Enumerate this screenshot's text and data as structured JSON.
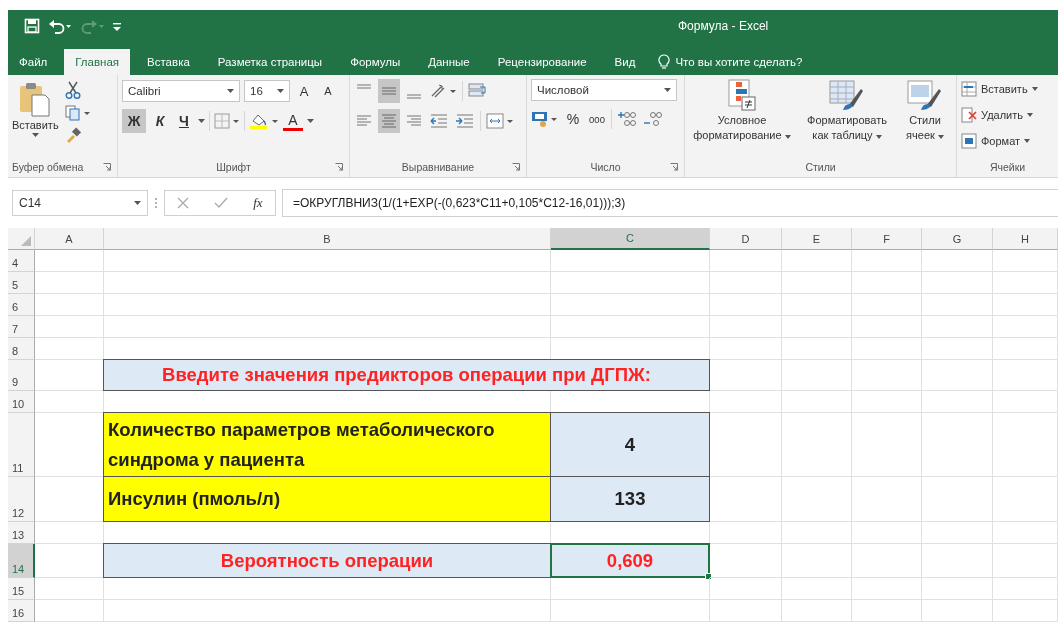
{
  "window": {
    "title": "Формула - Excel"
  },
  "tabs": [
    {
      "label": "Файл",
      "selected": false
    },
    {
      "label": "Главная",
      "selected": true
    },
    {
      "label": "Вставка",
      "selected": false
    },
    {
      "label": "Разметка страницы",
      "selected": false
    },
    {
      "label": "Формулы",
      "selected": false
    },
    {
      "label": "Данные",
      "selected": false
    },
    {
      "label": "Рецензирование",
      "selected": false
    },
    {
      "label": "Вид",
      "selected": false
    }
  ],
  "tell_me": {
    "placeholder": "Что вы хотите сделать?"
  },
  "ribbon": {
    "clipboard": {
      "paste": "Вставить",
      "label": "Буфер обмена"
    },
    "font": {
      "font_name": "Calibri",
      "font_size": "16",
      "grow": "A",
      "shrink": "A",
      "font_color_letter": "A",
      "label": "Шрифт",
      "style_buttons": [
        {
          "label": "Ж",
          "kind": "bold",
          "selected": true
        },
        {
          "label": "К",
          "kind": "italic",
          "selected": false
        },
        {
          "label": "Ч",
          "kind": "underline",
          "selected": false
        }
      ]
    },
    "alignment": {
      "label": "Выравнивание"
    },
    "number": {
      "format": "Числовой",
      "percent": "%",
      "thousands": "000",
      "label": "Число"
    },
    "styles": {
      "buttons": [
        {
          "label": "Условное форматирование",
          "kind": "conditional"
        },
        {
          "label": "Форматировать как таблицу",
          "kind": "table"
        },
        {
          "label": "Стили ячеек",
          "kind": "cell"
        }
      ],
      "label": "Стили"
    },
    "cells": {
      "buttons": [
        {
          "label": "Вставить",
          "kind": "insert"
        },
        {
          "label": "Удалить",
          "kind": "delete"
        },
        {
          "label": "Формат",
          "kind": "format"
        }
      ],
      "label": "Ячейки"
    }
  },
  "formula_bar": {
    "name_box": "C14",
    "fx": "fx",
    "formula": "=ОКРУГЛВНИЗ(1/(1+EXP(-(0,623*C11+0,105*C12-16,01)));3)"
  },
  "columns": [
    {
      "label": "A",
      "selected": false
    },
    {
      "label": "B",
      "selected": false
    },
    {
      "label": "C",
      "selected": true
    },
    {
      "label": "D",
      "selected": false
    },
    {
      "label": "E",
      "selected": false
    },
    {
      "label": "F",
      "selected": false
    },
    {
      "label": "G",
      "selected": false
    },
    {
      "label": "H",
      "selected": false
    }
  ],
  "rows": [
    {
      "number": "4",
      "kind": "blank",
      "selected": false
    },
    {
      "number": "5",
      "kind": "blank",
      "selected": false
    },
    {
      "number": "6",
      "kind": "blank",
      "selected": false
    },
    {
      "number": "7",
      "kind": "blank",
      "selected": false
    },
    {
      "number": "8",
      "kind": "blank",
      "selected": false
    },
    {
      "number": "9",
      "kind": "title",
      "selected": false,
      "label": "Введите значения предикторов операции при ДГПЖ:"
    },
    {
      "number": "10",
      "kind": "blank",
      "selected": false
    },
    {
      "number": "11",
      "kind": "input",
      "selected": false,
      "label": "Количество параметров метаболического синдрома у пациента",
      "value": "4"
    },
    {
      "number": "12",
      "kind": "input",
      "selected": false,
      "label": "Инсулин (пмоль/л)",
      "value": "133"
    },
    {
      "number": "13",
      "kind": "blank",
      "selected": false
    },
    {
      "number": "14",
      "kind": "result",
      "selected": true,
      "label": "Вероятность операции",
      "value": "0,609"
    },
    {
      "number": "15",
      "kind": "blank",
      "selected": false
    },
    {
      "number": "16",
      "kind": "blank",
      "selected": false
    }
  ]
}
